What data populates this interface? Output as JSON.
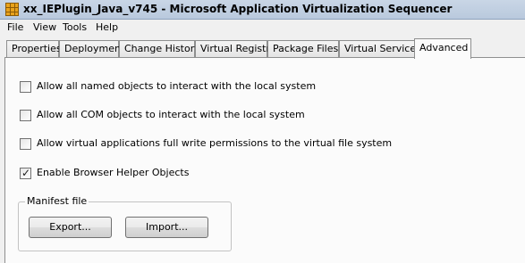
{
  "window": {
    "title": "xx_IEPlugin_Java_v745 - Microsoft Application Virtualization Sequencer",
    "icon": "sequencer-app-icon"
  },
  "menu": [
    "File",
    "View",
    "Tools",
    "Help"
  ],
  "tabs": [
    {
      "label": "Properties"
    },
    {
      "label": "Deployment"
    },
    {
      "label": "Change History"
    },
    {
      "label": "Virtual Registry"
    },
    {
      "label": "Package Files"
    },
    {
      "label": "Virtual Services"
    },
    {
      "label": "Advanced",
      "active": true
    }
  ],
  "options": [
    {
      "label": "Allow all named objects to interact with the local system",
      "checked": false
    },
    {
      "label": "Allow all COM objects to interact with the local system",
      "checked": false
    },
    {
      "label": "Allow virtual applications full write permissions to the virtual file system",
      "checked": false
    },
    {
      "label": "Enable Browser Helper Objects",
      "checked": true
    }
  ],
  "manifest": {
    "group_label": "Manifest file",
    "export_label": "Export...",
    "import_label": "Import..."
  }
}
